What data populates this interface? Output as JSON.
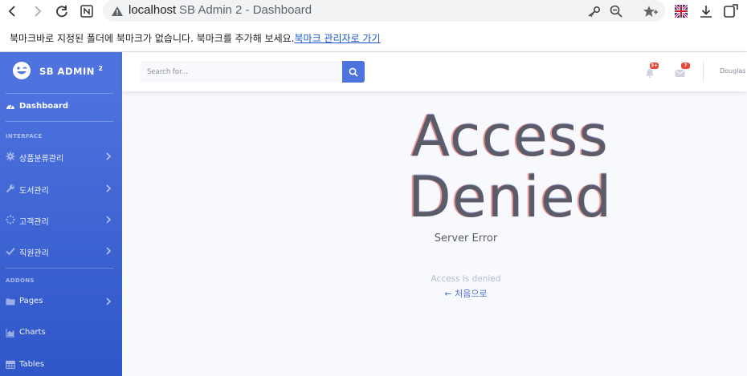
{
  "browser": {
    "host": "localhost",
    "tab_title": "SB Admin 2 - Dashboard"
  },
  "bookmark_bar": {
    "message": "북마크바로 지정된 폴더에 북마크가 없습니다. 북마크를 추가해 보세요.",
    "link": "북마크 관리자로 가기"
  },
  "sidebar": {
    "brand": "SB ADMIN",
    "brand_sup": "2",
    "dashboard": "Dashboard",
    "heading_interface": "INTERFACE",
    "heading_addons": "ADDONS",
    "items": [
      {
        "label": "상품분류관리",
        "icon": "cog-icon"
      },
      {
        "label": "도서관리",
        "icon": "wrench-icon"
      },
      {
        "label": "고객관리",
        "icon": "spinner-icon"
      },
      {
        "label": "직원관리",
        "icon": "check-icon"
      }
    ],
    "addons": [
      {
        "label": "Pages",
        "icon": "folder-icon"
      },
      {
        "label": "Charts",
        "icon": "chart-area-icon"
      },
      {
        "label": "Tables",
        "icon": "table-icon"
      }
    ]
  },
  "topbar": {
    "search_placeholder": "Search for...",
    "alerts_badge": "3+",
    "messages_badge": "7",
    "user_name": "Douglas"
  },
  "error": {
    "line1": "Access",
    "line2": "Denied",
    "subtitle": "Server Error",
    "message": "Access is denied",
    "back": "← 처음으로"
  },
  "colors": {
    "primary": "#4e73df",
    "danger": "#e74a3b",
    "text_gray": "#5a5c69"
  }
}
